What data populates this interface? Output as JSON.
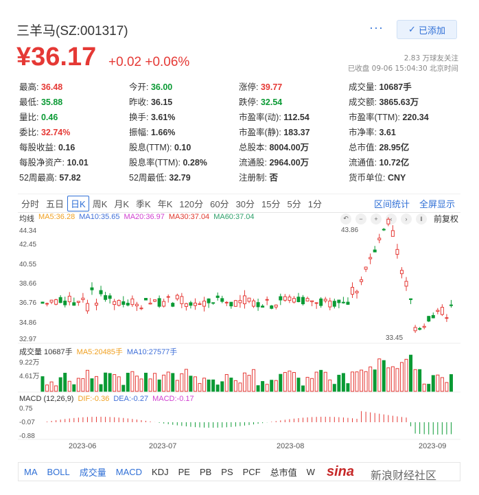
{
  "header": {
    "title": "三羊马(SZ:001317)",
    "more": "···",
    "added_label": "已添加"
  },
  "quote": {
    "price": "¥36.17",
    "change": "+0.02 +0.06%",
    "followers": "2.83 万球友关注",
    "status": "已收盘 09-06 15:04:30 北京时间"
  },
  "stats": [
    [
      {
        "k": "最高:",
        "v": "36.48",
        "c": "up"
      },
      {
        "k": "今开:",
        "v": "36.00",
        "c": "dn"
      },
      {
        "k": "涨停:",
        "v": "39.77",
        "c": "up"
      },
      {
        "k": "成交量:",
        "v": "10687手",
        "c": ""
      }
    ],
    [
      {
        "k": "最低:",
        "v": "35.88",
        "c": "dn"
      },
      {
        "k": "昨收:",
        "v": "36.15",
        "c": ""
      },
      {
        "k": "跌停:",
        "v": "32.54",
        "c": "dn"
      },
      {
        "k": "成交额:",
        "v": "3865.63万",
        "c": ""
      }
    ],
    [
      {
        "k": "量比:",
        "v": "0.46",
        "c": "dn"
      },
      {
        "k": "换手:",
        "v": "3.61%",
        "c": ""
      },
      {
        "k": "市盈率(动):",
        "v": "112.54",
        "c": ""
      },
      {
        "k": "市盈率(TTM):",
        "v": "220.34",
        "c": ""
      }
    ],
    [
      {
        "k": "委比:",
        "v": "32.74%",
        "c": "up"
      },
      {
        "k": "振幅:",
        "v": "1.66%",
        "c": ""
      },
      {
        "k": "市盈率(静):",
        "v": "183.37",
        "c": ""
      },
      {
        "k": "市净率:",
        "v": "3.61",
        "c": ""
      }
    ],
    [
      {
        "k": "每股收益:",
        "v": "0.16",
        "c": ""
      },
      {
        "k": "股息(TTM):",
        "v": "0.10",
        "c": ""
      },
      {
        "k": "总股本:",
        "v": "8004.00万",
        "c": ""
      },
      {
        "k": "总市值:",
        "v": "28.95亿",
        "c": ""
      }
    ],
    [
      {
        "k": "每股净资产:",
        "v": "10.01",
        "c": ""
      },
      {
        "k": "股息率(TTM):",
        "v": "0.28%",
        "c": ""
      },
      {
        "k": "流通股:",
        "v": "2964.00万",
        "c": ""
      },
      {
        "k": "流通值:",
        "v": "10.72亿",
        "c": ""
      }
    ],
    [
      {
        "k": "52周最高:",
        "v": "57.82",
        "c": ""
      },
      {
        "k": "52周最低:",
        "v": "32.79",
        "c": ""
      },
      {
        "k": "注册制:",
        "v": "否",
        "c": ""
      },
      {
        "k": "货币单位:",
        "v": "CNY",
        "c": ""
      }
    ]
  ],
  "tabs": [
    "分时",
    "五日",
    "日K",
    "周K",
    "月K",
    "季K",
    "年K",
    "120分",
    "60分",
    "30分",
    "15分",
    "5分",
    "1分"
  ],
  "tab_links": [
    "区间统计",
    "全屏显示"
  ],
  "ma": {
    "label": "均线",
    "ma5": "MA5:36.28",
    "ma10": "MA10:35.65",
    "ma20": "MA20:36.97",
    "ma30": "MA30:37.04",
    "ma60": "MA60:37.04",
    "fq": "前复权"
  },
  "price_axis": [
    "44.34",
    "42.45",
    "40.55",
    "38.66",
    "36.76",
    "34.86",
    "32.97"
  ],
  "price_marks": {
    "high": "43.86",
    "low": "33.45"
  },
  "vol": {
    "label": "成交量 10687手",
    "ma5": "MA5:20485手",
    "ma10": "MA10:27577手",
    "axis": [
      "9.22万",
      "4.61万"
    ]
  },
  "macd": {
    "label": "MACD (12,26,9)",
    "dif": "DIF:-0.36",
    "dea": "DEA:-0.27",
    "macd": "MACD:-0.17",
    "axis": [
      "0.75",
      "-0.07",
      "-0.88"
    ]
  },
  "xaxis": [
    "2023-06",
    "2023-07",
    "2023-08",
    "2023-09"
  ],
  "bottom_tabs": [
    "MA",
    "BOLL",
    "成交量",
    "MACD",
    "KDJ",
    "PE",
    "PB",
    "PS",
    "PCF",
    "总市值",
    "W"
  ],
  "watermark": {
    "brand": "sina",
    "text": "新浪财经社区"
  },
  "colors": {
    "up": "#e53935",
    "down": "#0a9a34",
    "accent": "#2f6fd6"
  }
}
